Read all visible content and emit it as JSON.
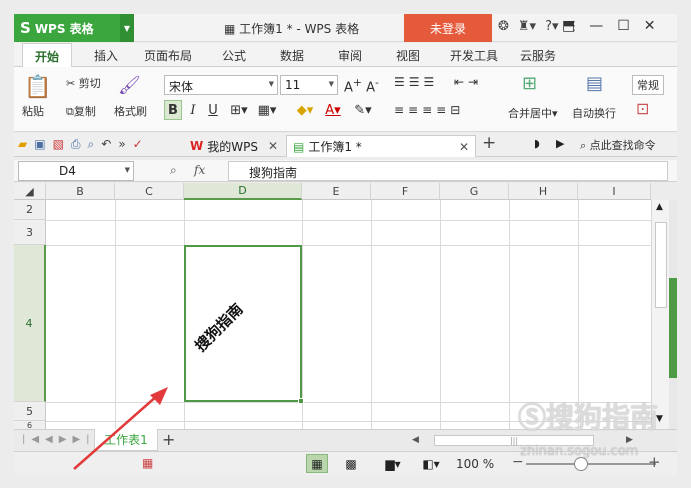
{
  "app": {
    "name": "WPS 表格",
    "logo_glyph": "S"
  },
  "title": {
    "doc_title": "工作簿1 * - WPS 表格",
    "login_label": "未登录"
  },
  "menu": {
    "tabs": [
      "开始",
      "插入",
      "页面布局",
      "公式",
      "数据",
      "审阅",
      "视图",
      "开发工具",
      "云服务"
    ],
    "active": "开始"
  },
  "ribbon": {
    "paste": "粘贴",
    "cut": "剪切",
    "copy": "复制",
    "format_painter": "格式刷",
    "font_name": "宋体",
    "font_size": "11",
    "bold": "B",
    "italic": "I",
    "underline": "U",
    "merge_center": "合并居中",
    "wrap_text": "自动换行",
    "number_format": "常规"
  },
  "doc_tabs": [
    {
      "label": "我的WPS",
      "active": false
    },
    {
      "label": "工作簿1 *",
      "active": true
    }
  ],
  "search": {
    "label": "点此查找命令"
  },
  "formula_bar": {
    "name_box": "D4",
    "fx_label": "fx",
    "content": "搜狗指南"
  },
  "grid": {
    "columns": [
      "B",
      "C",
      "D",
      "E",
      "F",
      "G",
      "H",
      "I"
    ],
    "selected_column": "D",
    "rows": [
      "2",
      "3",
      "4",
      "5",
      "6"
    ],
    "selected_row": "4",
    "active_cell_text": "搜狗指南"
  },
  "sheets": {
    "tabs": [
      "工作表1"
    ]
  },
  "status": {
    "zoom": "100 %"
  },
  "watermark": {
    "brand": "搜狗指南",
    "url": "zhinan.sogou.com"
  },
  "colors": {
    "accent": "#3aa63d",
    "login": "#e65a3c",
    "selection": "#4f9a46",
    "arrow": "#e23a3a"
  }
}
